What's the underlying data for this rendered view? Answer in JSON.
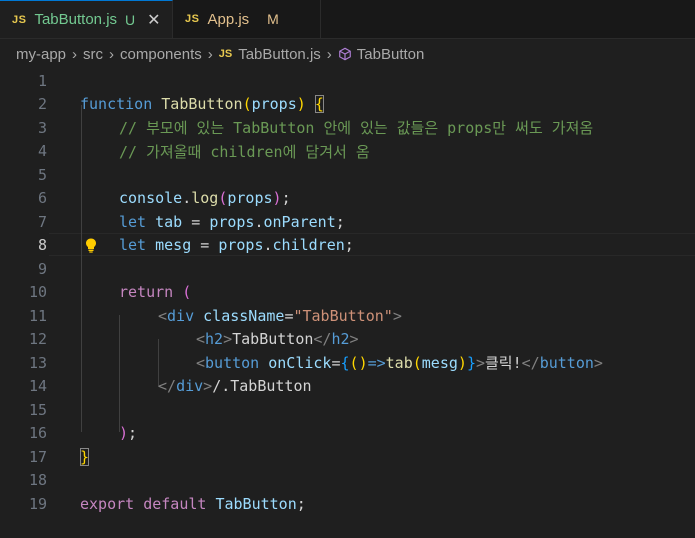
{
  "tabs": [
    {
      "badge": "JS",
      "name": "TabButton.js",
      "status": "U",
      "close": "✕",
      "active": true
    },
    {
      "badge": "JS",
      "name": "App.js",
      "status": "M",
      "active": false
    }
  ],
  "breadcrumb": {
    "parts": [
      "my-app",
      "src",
      "components"
    ],
    "file_badge": "JS",
    "file": "TabButton.js",
    "symbol": "TabButton",
    "separator": "›"
  },
  "editor": {
    "current_line": 8,
    "line_numbers": [
      "1",
      "2",
      "3",
      "4",
      "5",
      "6",
      "7",
      "8",
      "9",
      "10",
      "11",
      "12",
      "13",
      "14",
      "15",
      "16",
      "17",
      "18",
      "19"
    ],
    "code": {
      "l2_function": "function",
      "l2_name": "TabButton",
      "l2_paren_open": "(",
      "l2_param": "props",
      "l2_paren_close": ")",
      "l2_brace": "{",
      "l3_comment": "// 부모에 있는 TabButton 안에 있는 값들은 props만 써도 가져옴",
      "l4_comment": "// 가져올때 children에 담겨서 옴",
      "l6_console": "console",
      "l6_log": "log",
      "l6_arg": "props",
      "l7_let": "let",
      "l7_var": "tab",
      "l7_obj": "props",
      "l7_prop": "onParent",
      "l8_let": "let",
      "l8_var": "mesg",
      "l8_obj": "props",
      "l8_prop": "children",
      "l10_return": "return",
      "l10_paren": "(",
      "l11_tag": "div",
      "l11_attr": "className",
      "l11_value": "\"TabButton\"",
      "l12_tag": "h2",
      "l12_text": "TabButton",
      "l13_tag": "button",
      "l13_attr": "onClick",
      "l13_fn": "tab",
      "l13_arg": "mesg",
      "l13_text": "클릭!",
      "l14_tag": "div",
      "l14_text": "/.TabButton",
      "l16_close": ")",
      "l17_brace": "}",
      "l19_export": "export",
      "l19_default": "default",
      "l19_name": "TabButton"
    }
  }
}
